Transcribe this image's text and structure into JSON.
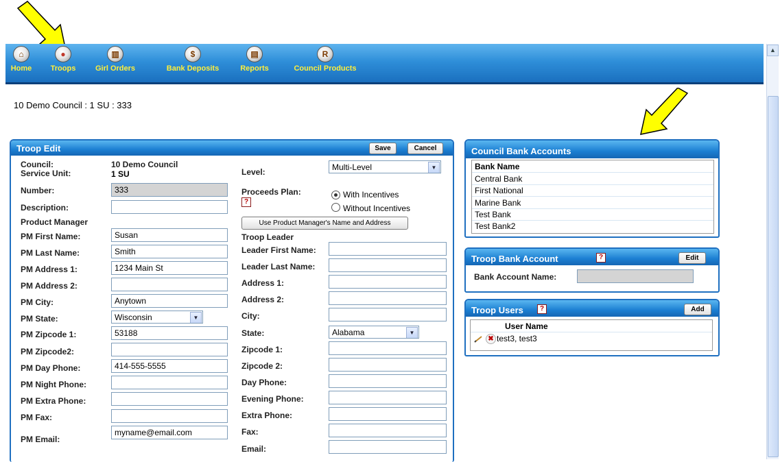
{
  "nav": {
    "items": [
      {
        "label": "Home",
        "icon": "home-icon"
      },
      {
        "label": "Troops",
        "icon": "troops-icon"
      },
      {
        "label": "Girl Orders",
        "icon": "basket-icon"
      },
      {
        "label": "Bank Deposits",
        "icon": "dollar-icon"
      },
      {
        "label": "Reports",
        "icon": "reports-icon"
      },
      {
        "label": "Council Products",
        "icon": "product-icon"
      }
    ]
  },
  "breadcrumb": "10 Demo Council : 1 SU : 333",
  "troop_edit": {
    "title": "Troop Edit",
    "save_label": "Save",
    "cancel_label": "Cancel",
    "council_label": "Council:",
    "council_value": "10 Demo Council",
    "service_unit_label": "Service Unit:",
    "service_unit_value": "1 SU",
    "number_label": "Number:",
    "number_value": "333",
    "description_label": "Description:",
    "description_value": "",
    "product_manager_label": "Product Manager",
    "pm_first_name_label": "PM First Name:",
    "pm_first_name_value": "Susan",
    "pm_last_name_label": "PM Last Name:",
    "pm_last_name_value": "Smith",
    "pm_address1_label": "PM Address 1:",
    "pm_address1_value": "1234 Main St",
    "pm_address2_label": "PM Address 2:",
    "pm_address2_value": "",
    "pm_city_label": "PM City:",
    "pm_city_value": "Anytown",
    "pm_state_label": "PM State:",
    "pm_state_value": "Wisconsin",
    "pm_zip1_label": "PM Zipcode 1:",
    "pm_zip1_value": "53188",
    "pm_zip2_label": "PM Zipcode2:",
    "pm_zip2_value": "",
    "pm_day_phone_label": "PM Day Phone:",
    "pm_day_phone_value": "414-555-5555",
    "pm_night_phone_label": "PM Night Phone:",
    "pm_night_phone_value": "",
    "pm_extra_phone_label": "PM Extra Phone:",
    "pm_extra_phone_value": "",
    "pm_fax_label": "PM Fax:",
    "pm_fax_value": "",
    "pm_email_label": "PM Email:",
    "pm_email_value": "myname@email.com",
    "level_label": "Level:",
    "level_value": "Multi-Level",
    "proceeds_label": "Proceeds Plan:",
    "proceeds_opt1": "With Incentives",
    "proceeds_opt2": "Without Incentives",
    "use_pm_button": "Use Product Manager's Name and Address",
    "troop_leader_label": "Troop Leader",
    "leader_first_label": "Leader First Name:",
    "leader_last_label": "Leader Last Name:",
    "address1_label": "Address 1:",
    "address2_label": "Address 2:",
    "city_label": "City:",
    "state_label": "State:",
    "state_value": "Alabama",
    "zip1_label": "Zipcode 1:",
    "zip2_label": "Zipcode 2:",
    "day_phone_label": "Day Phone:",
    "evening_phone_label": "Evening Phone:",
    "extra_phone_label": "Extra Phone:",
    "fax_label": "Fax:",
    "email_label": "Email:"
  },
  "council_bank": {
    "title": "Council Bank Accounts",
    "header": "Bank Name",
    "banks": [
      "Central Bank",
      "First National",
      "Marine Bank",
      "Test Bank",
      "Test Bank2"
    ]
  },
  "troop_bank": {
    "title": "Troop Bank Account",
    "edit_label": "Edit",
    "account_label": "Bank Account Name:",
    "account_value": ""
  },
  "troop_users": {
    "title": "Troop Users",
    "add_label": "Add",
    "header": "User Name",
    "users": [
      "test3, test3"
    ]
  },
  "colors": {
    "accent": "#1c7fd2",
    "nav_text": "#ffef3a",
    "arrow": "#ffff00"
  }
}
